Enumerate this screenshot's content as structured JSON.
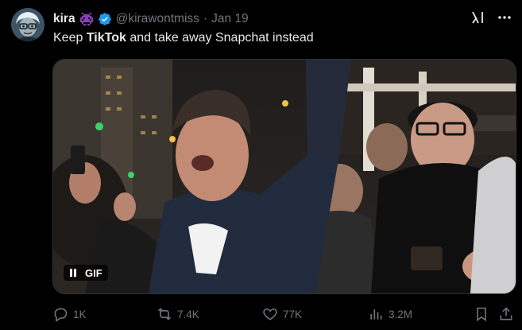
{
  "author": {
    "name": "kira",
    "handle": "@kirawontmiss",
    "date": "Jan 19",
    "separator": "·"
  },
  "tweet": {
    "text_before": "Keep ",
    "text_bold": "TikTok",
    "text_after": " and take away Snapchat instead"
  },
  "media": {
    "badge_label": "GIF"
  },
  "stats": {
    "replies": "1K",
    "retweets": "7.4K",
    "likes": "77K",
    "views": "3.2M"
  },
  "colors": {
    "background": "#000000",
    "text": "#e7e9ea",
    "muted": "#71767b",
    "verified": "#1d9bf0",
    "emoji": "#8b3fb5"
  }
}
